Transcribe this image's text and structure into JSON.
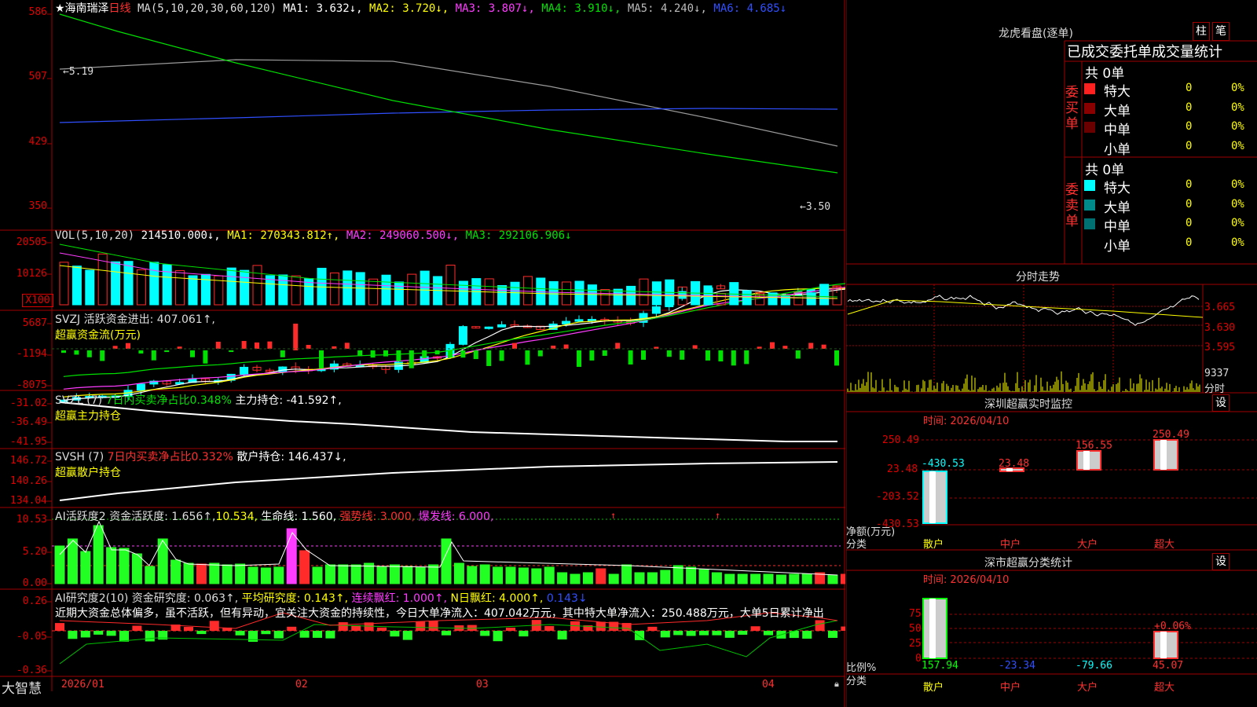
{
  "colors": {
    "up": "#ff2a2a",
    "down": "#00ffff",
    "grid": "#a00000",
    "axis": "#e00000",
    "white": "#ffffff",
    "yellow": "#ffff00",
    "magenta": "#ff3cff",
    "green": "#00e000",
    "blue": "#3050ff",
    "gray": "#9a9a9a"
  },
  "kline": {
    "stock": "★海南瑞泽",
    "period": "日线",
    "ma_label": "MA(5,10,20,30,60,120)",
    "ma1": "MA1: 3.632↓,",
    "ma2": "MA2: 3.720↓,",
    "ma3": "MA3: 3.807↓,",
    "ma4": "MA4: 3.910↓,",
    "ma5": "MA5: 4.240↓,",
    "ma6": "MA6: 4.685↓",
    "y_ticks": [
      "586",
      "507",
      "429",
      "350"
    ],
    "high_marker": "←5.19",
    "low_marker": "←3.50"
  },
  "vol": {
    "label": "VOL(5,10,20)",
    "value": "214510.000↓,",
    "ma1": "MA1: 270343.812↑,",
    "ma2": "MA2: 249060.500↓,",
    "ma3": "MA3: 292106.906↓",
    "y_ticks": [
      "20505",
      "10126"
    ],
    "unit": "X100"
  },
  "svzj": {
    "label": "SVZJ  活跃资金进出: 407.061↑,",
    "sub": "超赢资金流(万元)",
    "y_ticks": [
      "5687",
      "-1194",
      "-8075"
    ]
  },
  "svzl": {
    "label": "SVZL (7) ",
    "pct": "7日内买卖净占比0.348%",
    "hold": " 主力持仓: -41.592↑,",
    "sub": "超赢主力持仓",
    "y_ticks": [
      "-31.02",
      "-36.49",
      "-41.95"
    ]
  },
  "svsh": {
    "label": "SVSH (7) ",
    "pct": "7日内买卖净占比0.332%",
    "hold": " 散户持仓: 146.437↓,",
    "sub": "超赢散户持仓",
    "y_ticks": [
      "146.72",
      "140.26",
      "134.04"
    ]
  },
  "ai1": {
    "label": "AI活跃度2 资金活跃度: 1.656↑,",
    "v2": "10.534,",
    "life": " 生命线: 1.560,",
    "strong": " 强势线: 3.000,",
    "burst": " 爆发线: 6.000,",
    "y_ticks": [
      "10.53",
      "5.20",
      "0.00"
    ]
  },
  "ai2": {
    "label": "AI研究度2(10) 资金研究度: 0.063↑,",
    "avg": " 平均研究度: 0.143↑,",
    "cont": " 连续飘红: 1.000↑,",
    "nday": " N日飘红: 4.000↑,",
    "last": " 0.143↓",
    "comment": "近期大资金总体偏多，虽不活跃，但有异动，宜关注大资金的持续性，今日大单净流入：407.042万元，其中特大单净流入：250.488万元，大单5日累计净出",
    "y_ticks": [
      "0.26",
      "-0.05",
      "-0.36"
    ]
  },
  "bottom": {
    "logo": "大智慧",
    "dates": [
      "2026/01",
      "02",
      "03",
      "04"
    ]
  },
  "dragon": {
    "title": "龙虎看盘(逐单)",
    "btn_bar": "柱",
    "btn_pen": "笔",
    "stat_title": "已成交委托单成交量统计",
    "buy_label": "委买单",
    "sell_label": "委卖单",
    "buy_total": "共 0单",
    "sell_total": "共 0单",
    "rows": [
      "特大",
      "大单",
      "中单",
      "小单"
    ],
    "zero": "0",
    "pct": "0%"
  },
  "fenshi": {
    "title": "分时走势",
    "prices": [
      "3.665",
      "3.630",
      "3.595"
    ],
    "volume": "9337",
    "unit": "分时"
  },
  "sz_monitor": {
    "title": "深圳超赢实时监控",
    "btn": "设",
    "time": "时间: 2026/04/10",
    "y_ticks": [
      "250.49",
      "23.48",
      "-203.52",
      "-430.53"
    ],
    "ylabel": "净额(万元)",
    "xlabel": "分类",
    "categories": [
      "散户",
      "中户",
      "大户",
      "超大"
    ],
    "values": [
      "-430.53",
      "23.48",
      "156.55",
      "250.49"
    ]
  },
  "sz_class": {
    "title": "深市超赢分类统计",
    "btn": "设",
    "time": "时间: 2026/04/10",
    "y_ticks": [
      "75",
      "50",
      "25",
      "0"
    ],
    "ylabel": "比例%",
    "xlabel": "分类",
    "categories": [
      "散户",
      "中户",
      "大户",
      "超大"
    ],
    "values": [
      "157.94",
      "-23.34",
      "-79.66",
      "45.07"
    ],
    "note": "+0.06%"
  }
}
